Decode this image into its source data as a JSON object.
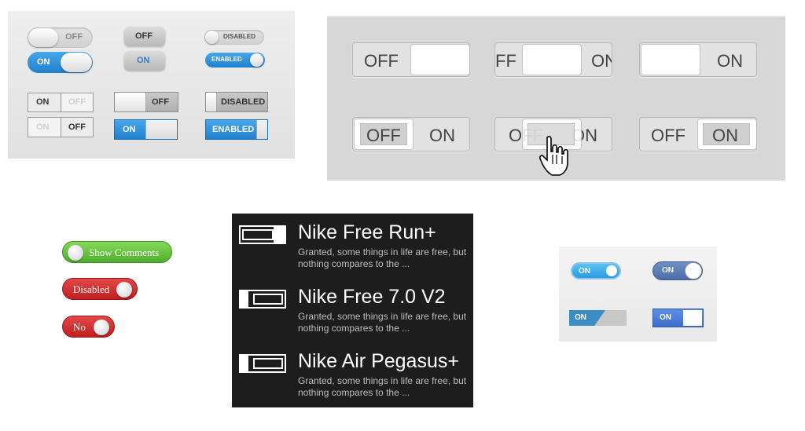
{
  "panel1": {
    "row1": {
      "off_pill": "OFF",
      "off_button": "OFF",
      "disabled_pill": "DISABLED"
    },
    "row2": {
      "on_pill": "ON",
      "on_button": "ON",
      "enabled_pill": "ENABLED"
    },
    "row3": {
      "seg_on": "ON",
      "seg_off": "OFF",
      "slide_off": "OFF",
      "slide_disabled": "DISABLED"
    },
    "row4": {
      "seg_on": "ON",
      "seg_off": "OFF",
      "slide_on": "ON",
      "slide_enabled": "ENABLED"
    }
  },
  "panel2": {
    "row1": [
      {
        "left": "OFF",
        "right": ""
      },
      {
        "left": "FF",
        "right": "ON"
      },
      {
        "left": "",
        "right": "ON"
      }
    ],
    "row2": [
      {
        "left": "OFF",
        "right": "ON"
      },
      {
        "left": "OFF",
        "right": "ON"
      },
      {
        "left": "OFF",
        "right": "ON"
      }
    ]
  },
  "panel3": {
    "show_comments": "Show Comments",
    "disabled": "Disabled",
    "no": "No"
  },
  "panel4": {
    "items": [
      {
        "title": "Nike Free Run+",
        "desc": "Granted, some things in life are free, but nothing compares to the ...",
        "state": "on"
      },
      {
        "title": "Nike Free 7.0 V2",
        "desc": "Granted, some things in life are free, but nothing compares to the ...",
        "state": "off"
      },
      {
        "title": "Nike Air Pegasus+",
        "desc": "Granted, some things in life are free, but nothing compares to the ...",
        "state": "off"
      }
    ]
  },
  "panel5": {
    "toggle1": "ON",
    "toggle2": "ON",
    "toggle3": "ON",
    "toggle4": "ON"
  },
  "colors": {
    "blue": "#2a8ad6",
    "green": "#5cbf3a",
    "red": "#cf2a2a",
    "dark_panel": "#1d1d1d"
  },
  "icons": [
    "hand-cursor-icon"
  ]
}
